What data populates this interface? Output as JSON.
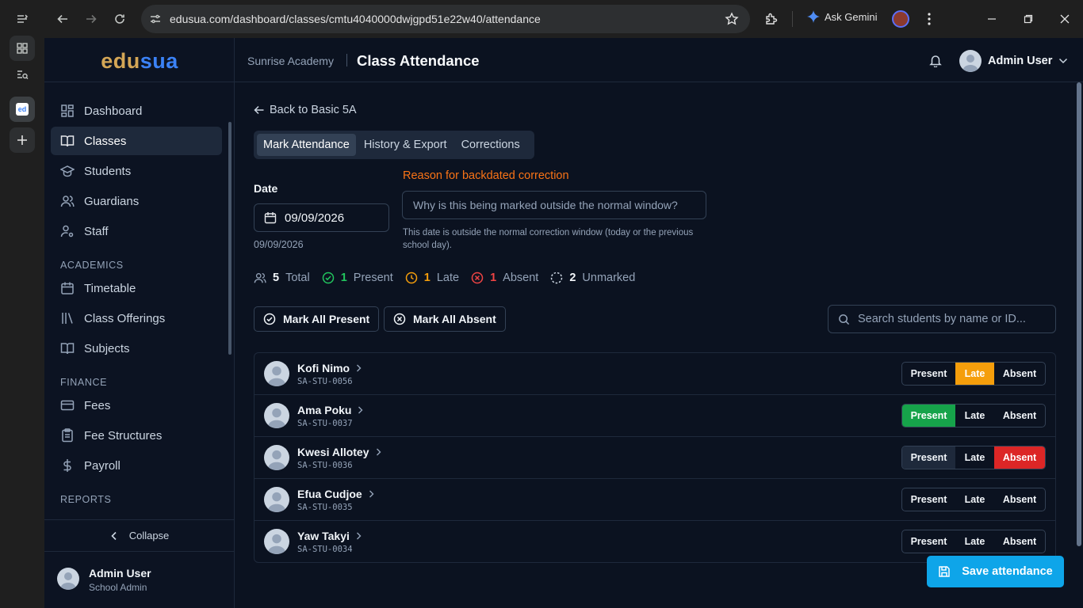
{
  "browser": {
    "url": "edusua.com/dashboard/classes/cmtu4040000dwjgpd51e22w40/attendance",
    "gemini_label": "Ask Gemini"
  },
  "sidebar": {
    "logo_a": "edu",
    "logo_b": "sua",
    "items": [
      {
        "label": "Dashboard",
        "icon": "dashboard-icon"
      },
      {
        "label": "Classes",
        "icon": "book-open-icon",
        "active": true
      },
      {
        "label": "Students",
        "icon": "graduation-cap-icon"
      },
      {
        "label": "Guardians",
        "icon": "users-icon"
      },
      {
        "label": "Staff",
        "icon": "user-cog-icon"
      }
    ],
    "section_academics": "ACADEMICS",
    "academics": [
      {
        "label": "Timetable",
        "icon": "calendar-icon"
      },
      {
        "label": "Class Offerings",
        "icon": "library-icon"
      },
      {
        "label": "Subjects",
        "icon": "book-icon"
      }
    ],
    "section_finance": "FINANCE",
    "finance": [
      {
        "label": "Fees",
        "icon": "credit-card-icon"
      },
      {
        "label": "Fee Structures",
        "icon": "clipboard-icon"
      },
      {
        "label": "Payroll",
        "icon": "dollar-icon"
      }
    ],
    "section_reports": "REPORTS",
    "collapse_label": "Collapse",
    "user_name": "Admin User",
    "user_role": "School Admin"
  },
  "header": {
    "school": "Sunrise Academy",
    "title": "Class Attendance",
    "user_name": "Admin User"
  },
  "main": {
    "back_label": "Back to Basic 5A",
    "tabs": [
      "Mark Attendance",
      "History & Export",
      "Corrections"
    ],
    "date_label": "Date",
    "date_value": "09/09/2026",
    "date_sub": "09/09/2026",
    "reason_label": "Reason for backdated correction",
    "reason_placeholder": "Why is this being marked outside the normal window?",
    "reason_help": "This date is outside the normal correction window (today or the previous school day).",
    "stats": {
      "total": "5",
      "total_label": "Total",
      "present": "1",
      "present_label": "Present",
      "late": "1",
      "late_label": "Late",
      "absent": "1",
      "absent_label": "Absent",
      "unmarked": "2",
      "unmarked_label": "Unmarked"
    },
    "mark_all_present": "Mark All Present",
    "mark_all_absent": "Mark All Absent",
    "search_placeholder": "Search students by name or ID...",
    "status_labels": {
      "present": "Present",
      "late": "Late",
      "absent": "Absent"
    },
    "students": [
      {
        "name": "Kofi Nimo",
        "id": "SA-STU-0056",
        "status": "late"
      },
      {
        "name": "Ama Poku",
        "id": "SA-STU-0037",
        "status": "present"
      },
      {
        "name": "Kwesi Allotey",
        "id": "SA-STU-0036",
        "status": "absent"
      },
      {
        "name": "Efua Cudjoe",
        "id": "SA-STU-0035",
        "status": ""
      },
      {
        "name": "Yaw Takyi",
        "id": "SA-STU-0034",
        "status": ""
      }
    ],
    "save_label": "Save attendance"
  },
  "colors": {
    "present": "#16a34a",
    "late": "#f59e0b",
    "absent": "#dc2626",
    "accent": "#0ea5e9",
    "warning": "#f97316"
  }
}
